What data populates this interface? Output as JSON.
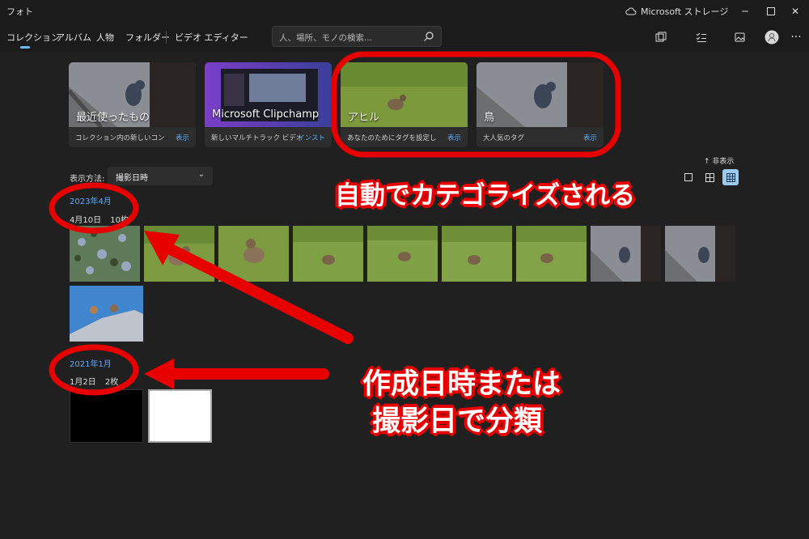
{
  "window": {
    "title": "フォト",
    "store_label": "Microsoft ストレージ"
  },
  "nav": {
    "items": [
      "コレクション",
      "アルバム",
      "人物",
      "フォルダー"
    ],
    "video_editor": "ビデオ エディター",
    "search_placeholder": "人、場所、モノの検索..."
  },
  "cards": [
    {
      "title": "最近使ったもの",
      "subtitle": "コレクション内の新しいコンテ...",
      "link": "表示"
    },
    {
      "title": "Microsoft Clipchamp",
      "subtitle": "新しいマルチトラック ビデオ エ...",
      "link": "インスト"
    },
    {
      "title": "アヒル",
      "subtitle": "あなたのためにタグを設定し...",
      "link": "表示"
    },
    {
      "title": "鳥",
      "subtitle": "大人気のタグ",
      "link": "表示"
    }
  ],
  "sort": {
    "label": "表示方法:",
    "value": "撮影日時"
  },
  "hide_label": "非表示",
  "groups": [
    {
      "month": "2023年4月",
      "day": "4月10日",
      "count": "10枚"
    },
    {
      "month": "2021年1月",
      "day": "1月2日",
      "count": "2枚"
    }
  ],
  "annotations": {
    "auto_category": "自動でカテゴライズされる",
    "date_line1": "作成日時または",
    "date_line2": "撮影日で分類"
  },
  "colors": {
    "accent": "#5aa8ff",
    "annotation_red": "#e60000",
    "background": "#202020"
  }
}
